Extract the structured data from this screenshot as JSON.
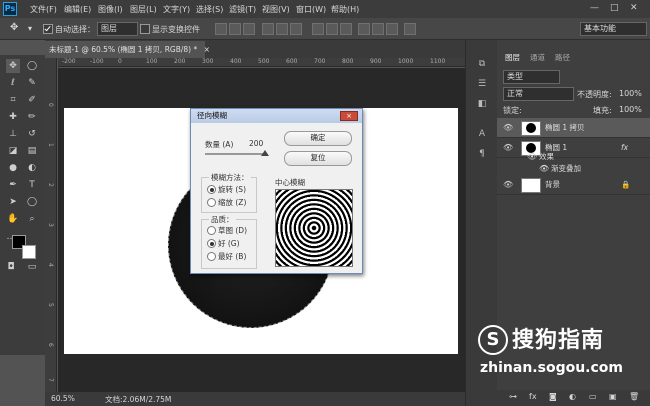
{
  "app": {
    "logo": "Ps"
  },
  "menu": [
    "文件(F)",
    "编辑(E)",
    "图像(I)",
    "图层(L)",
    "文字(Y)",
    "选择(S)",
    "滤镜(T)",
    "视图(V)",
    "窗口(W)",
    "帮助(H)"
  ],
  "window_controls": [
    "—",
    "□",
    "✕"
  ],
  "options_bar": {
    "auto_select_label": "自动选择：",
    "auto_select_value": "图层",
    "show_transform_label": "显示变换控件",
    "workspace": "基本功能"
  },
  "document_tab": {
    "title": "未标题-1 @ 60.5% (椭圆 1 拷贝, RGB/8) *",
    "close": "×"
  },
  "ruler_top": [
    "-200",
    "-100",
    "0",
    "100",
    "200",
    "300",
    "400",
    "500",
    "600",
    "700",
    "800",
    "900",
    "1000",
    "1100"
  ],
  "ruler_left": [
    "0",
    "1",
    "2",
    "3",
    "4",
    "5",
    "6",
    "7"
  ],
  "status": {
    "zoom": "60.5%",
    "doc_info": "文档:2.06M/2.75M"
  },
  "dialog": {
    "title": "径向模糊",
    "close_icon": "×",
    "amount_label": "数量 (A)",
    "amount_value": "200",
    "ok_label": "确定",
    "reset_label": "复位",
    "method_group": "模糊方法：",
    "methods": [
      {
        "label": "旋转 (S)",
        "selected": true
      },
      {
        "label": "缩放 (Z)",
        "selected": false
      }
    ],
    "quality_group": "品质：",
    "qualities": [
      {
        "label": "草图 (D)",
        "selected": false
      },
      {
        "label": "好 (G)",
        "selected": true
      },
      {
        "label": "最好 (B)",
        "selected": false
      }
    ],
    "center_label": "中心模糊"
  },
  "layers_panel": {
    "tabs": [
      "图层",
      "通道",
      "路径"
    ],
    "filter_kind": "类型",
    "blend_mode": "正常",
    "opacity_label": "不透明度:",
    "opacity_value": "100%",
    "lock_label": "锁定:",
    "fill_label": "填充:",
    "fill_value": "100%",
    "layers": [
      {
        "name": "椭圆 1 拷贝",
        "selected": true
      },
      {
        "name": "椭圆 1",
        "fx": "fx"
      },
      {
        "name": "效果"
      },
      {
        "name": "渐变叠加"
      },
      {
        "name": "背景",
        "locked": true
      }
    ]
  },
  "watermark": {
    "logo": "S",
    "brand": "搜狗指南",
    "url": "zhinan.sogou.com"
  }
}
